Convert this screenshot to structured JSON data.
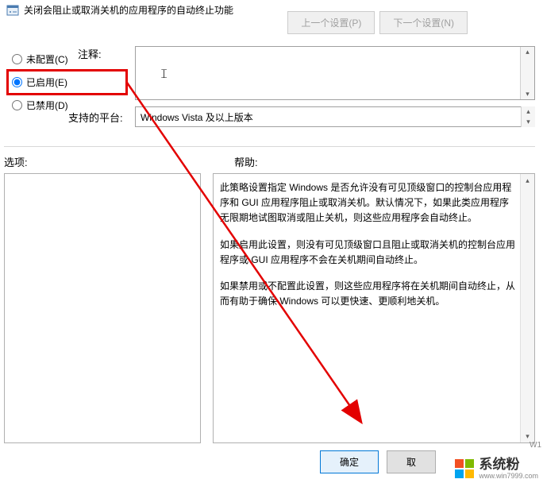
{
  "header": {
    "title": "关闭会阻止或取消关机的应用程序的自动终止功能"
  },
  "nav": {
    "prev": "上一个设置(P)",
    "next": "下一个设置(N)"
  },
  "radios": {
    "not_configured": "未配置(C)",
    "enabled": "已启用(E)",
    "disabled": "已禁用(D)"
  },
  "labels": {
    "comment": "注释:",
    "platform": "支持的平台:",
    "options": "选项:",
    "help": "帮助:"
  },
  "platform_value": "Windows Vista 及以上版本",
  "help_text": {
    "p1": "此策略设置指定 Windows 是否允许没有可见顶级窗口的控制台应用程序和 GUI 应用程序阻止或取消关机。默认情况下，如果此类应用程序无限期地试图取消或阻止关机，则这些应用程序会自动终止。",
    "p2": "如果启用此设置，则没有可见顶级窗口且阻止或取消关机的控制台应用程序或 GUI 应用程序不会在关机期间自动终止。",
    "p3": "如果禁用或不配置此设置，则这些应用程序将在关机期间自动终止，从而有助于确保 Windows 可以更快速、更顺利地关机。"
  },
  "buttons": {
    "ok": "确定",
    "cancel": "取"
  },
  "watermark": {
    "brand": "系统粉",
    "site": "www.win7999.com",
    "partial": "W1"
  }
}
